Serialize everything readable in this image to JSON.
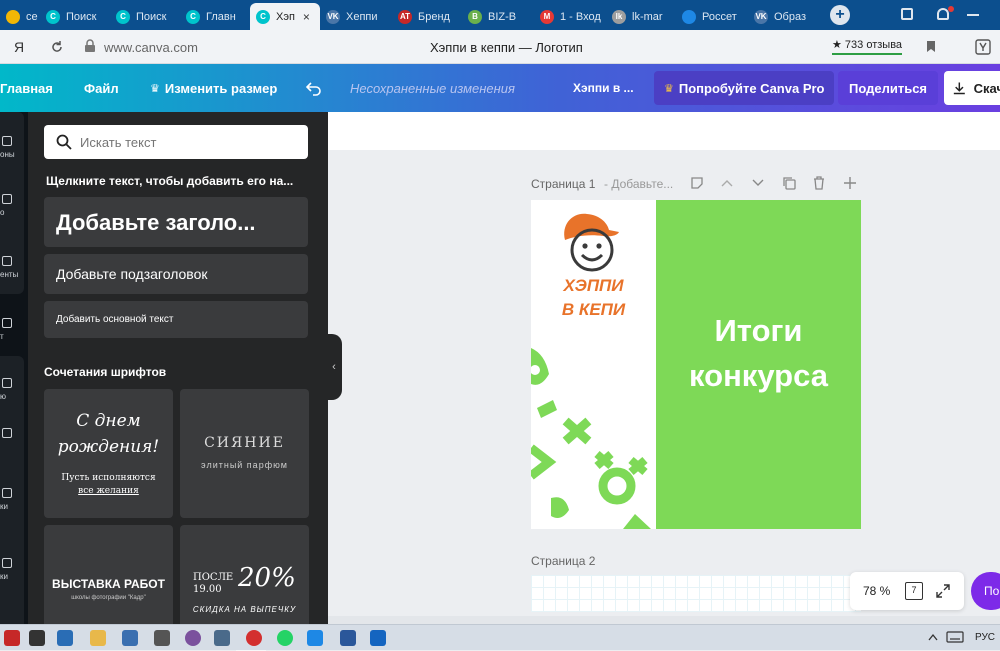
{
  "browser": {
    "tabs": [
      {
        "label": "се ди",
        "favicon_color": "#f2b705",
        "favicon_glyph": ""
      },
      {
        "label": "Поиск",
        "favicon_color": "#00c4cc",
        "favicon_glyph": "C"
      },
      {
        "label": "Поиск",
        "favicon_color": "#00c4cc",
        "favicon_glyph": "C"
      },
      {
        "label": "Главн",
        "favicon_color": "#00c4cc",
        "favicon_glyph": "C"
      },
      {
        "label": "Хэп",
        "favicon_color": "#00c4cc",
        "favicon_glyph": "C",
        "active": true
      },
      {
        "label": "Хеппи",
        "favicon_color": "#4a76a8",
        "favicon_glyph": "VK"
      },
      {
        "label": "Бренд",
        "favicon_color": "#c62828",
        "favicon_glyph": "AT"
      },
      {
        "label": "BIZ-B",
        "favicon_color": "#6ab04c",
        "favicon_glyph": "B"
      },
      {
        "label": "1 - Вход",
        "favicon_color": "#e53935",
        "favicon_glyph": "M"
      },
      {
        "label": "lk-mar",
        "favicon_color": "#9e9e9e",
        "favicon_glyph": "lk"
      },
      {
        "label": "Россет",
        "favicon_color": "#1e88e5",
        "favicon_glyph": ""
      },
      {
        "label": "Образ",
        "favicon_color": "#4a76a8",
        "favicon_glyph": "VK"
      }
    ],
    "new_tab": "+",
    "address": {
      "back": "Я",
      "url": "www.canva.com",
      "page_title": "Хэппи в кеппи — Логотип",
      "reviews": "★ 733 отзыва"
    }
  },
  "toolbar": {
    "home": "Главная",
    "file": "Файл",
    "resize": "Изменить размер",
    "unsaved": "Несохраненные изменения",
    "design_name": "Хэппи в ...",
    "try_pro": "Попробуйте Canva Pro",
    "share": "Поделиться",
    "download": "Скач"
  },
  "rail": {
    "items": [
      "оны",
      "о",
      "енты",
      "т",
      "ю",
      "",
      "ки",
      "ки"
    ]
  },
  "panel": {
    "search_placeholder": "Искать текст",
    "hint": "Щелкните текст, чтобы добавить его на...",
    "add_heading": "Добавьте заголо...",
    "add_subheading": "Добавьте подзаголовок",
    "add_body": "Добавить основной текст",
    "font_combos_title": "Сочетания шрифтов",
    "cards": [
      {
        "line1": "С днем",
        "line2": "рождения!",
        "line3": "Пусть исполняются",
        "line4": "все желания"
      },
      {
        "line1": "СИЯНИЕ",
        "line2": "элитный парфюм"
      },
      {
        "line1": "ВЫСТАВКА РАБОТ",
        "line2": "школы фотографии \"Кадр\""
      },
      {
        "line1": "ПОСЛЕ",
        "line2": "19.00",
        "line3": "20%",
        "line4": "СКИДКА НА ВЫПЕЧКУ"
      }
    ]
  },
  "canvas": {
    "page1_label": "Страница 1",
    "page1_sub": "- Добавьте...",
    "page2_label": "Страница 2",
    "logo_line1": "ХЭППИ",
    "logo_line2": "В КЕПИ",
    "result_line1": "Итоги",
    "result_line2": "конкурса",
    "zoom": "78 %",
    "page_count": "7",
    "help": "По",
    "colors": {
      "green": "#7ed957",
      "orange": "#e8732a"
    }
  },
  "taskbar": {
    "lang": "РУС"
  }
}
